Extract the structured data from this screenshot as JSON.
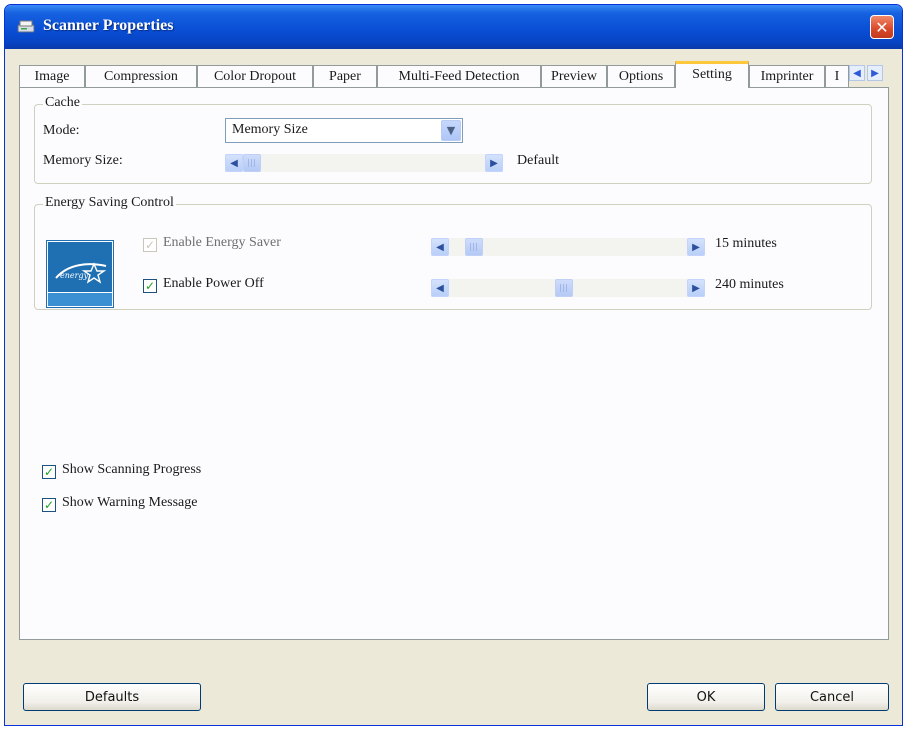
{
  "window": {
    "title": "Scanner Properties",
    "close_glyph": "✕"
  },
  "tabs": [
    {
      "label": "Image"
    },
    {
      "label": "Compression"
    },
    {
      "label": "Color Dropout"
    },
    {
      "label": "Paper"
    },
    {
      "label": "Multi-Feed Detection"
    },
    {
      "label": "Preview"
    },
    {
      "label": "Options"
    },
    {
      "label": "Setting"
    },
    {
      "label": "Imprinter"
    },
    {
      "label": "I"
    }
  ],
  "active_tab": "Setting",
  "tab_scroll": {
    "left": "◀",
    "right": "▶"
  },
  "cache": {
    "group_label": "Cache",
    "mode_label": "Mode:",
    "mode_value": "Memory Size",
    "memory_size_label": "Memory Size:",
    "memory_size_value": "Default"
  },
  "energy": {
    "group_label": "Energy Saving Control",
    "logo_text": "ENERGY STAR",
    "energy_saver_label": "Enable Energy Saver",
    "energy_saver_checked": true,
    "energy_saver_enabled": false,
    "energy_saver_value": "15 minutes",
    "power_off_label": "Enable Power Off",
    "power_off_checked": true,
    "power_off_value": "240 minutes"
  },
  "options": {
    "show_progress_label": "Show Scanning Progress",
    "show_progress_checked": true,
    "show_warning_label": "Show Warning Message",
    "show_warning_checked": true
  },
  "buttons": {
    "defaults": "Defaults",
    "ok": "OK",
    "cancel": "Cancel"
  },
  "glyphs": {
    "check": "✓",
    "arrow_left": "◀",
    "arrow_right": "▶",
    "dropdown": "▼"
  },
  "colors": {
    "title_bar": "#0a4fd6",
    "active_tab_highlight": "#ffc73c",
    "check_green": "#21a121"
  }
}
